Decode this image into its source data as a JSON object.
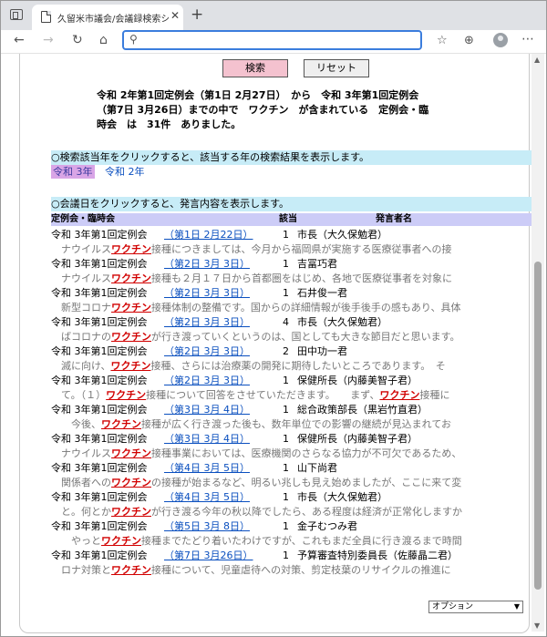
{
  "browser": {
    "tab_title": "久留米市議会/会議録検索システム",
    "tab_close": "✕",
    "new_tab": "+",
    "nav": {
      "back": "←",
      "forward": "→",
      "reload": "↻",
      "home": "⌂",
      "search_glyph": "⚲"
    },
    "address_value": "",
    "right_icons": {
      "favorites": "☆",
      "collections": "⊕",
      "menu": "⋯"
    }
  },
  "page": {
    "buttons": {
      "search_label": "検索",
      "reset_label": "リセット"
    },
    "summary": {
      "line1": "令和 2年第1回定例会（第1日 2月27日）　から　令和 3年第1回定例会",
      "line2": "（第7日 3月26日）までの中で　ワクチン　が含まれている　定例会・臨",
      "line3": "時会　は　31件　ありました。"
    },
    "year_hint": "○検索該当年をクリックすると、該当する年の検索結果を表示します。",
    "years": [
      "令和 3年",
      "令和 2年"
    ],
    "active_year": "令和 3年",
    "meeting_hint": "○会議日をクリックすると、発言内容を表示します。",
    "columns": {
      "meeting": "定例会・臨時会",
      "hits": "該当",
      "speaker": "発言者名"
    },
    "keyword": "ワクチン",
    "results": [
      {
        "session": "令和 3年第1回定例会",
        "date": "（第1日 2月22日）",
        "count": "1",
        "speaker": "市長（大久保勉君）",
        "pre": "　ナウイルス",
        "post": "接種につきましては、今月から福岡県が実施する医療従事者への接"
      },
      {
        "session": "令和 3年第1回定例会",
        "date": "（第2日 3月 3日）",
        "count": "1",
        "speaker": "吉冨巧君",
        "pre": "　ナウイルス",
        "post": "接種も２月１７日から首都圏をはじめ、各地で医療従事者を対象に"
      },
      {
        "session": "令和 3年第1回定例会",
        "date": "（第2日 3月 3日）",
        "count": "1",
        "speaker": "石井俊一君",
        "pre": "　新型コロナ",
        "post": "接種体制の整備です。国からの詳細情報が後手後手の感もあり、具体"
      },
      {
        "session": "令和 3年第1回定例会",
        "date": "（第2日 3月 3日）",
        "count": "4",
        "speaker": "市長（大久保勉君）",
        "pre": "　ばコロナの",
        "post": "が行き渡っていくというのは、国としても大きな節目だと思います。"
      },
      {
        "session": "令和 3年第1回定例会",
        "date": "（第2日 3月 3日）",
        "count": "2",
        "speaker": "田中功一君",
        "pre": "　滅に向け、",
        "post": "接種、さらには治療薬の開発に期待したいところであります。　そ"
      },
      {
        "session": "令和 3年第1回定例会",
        "date": "（第2日 3月 3日）",
        "count": "1",
        "speaker": "保健所長（内藤美智子君）",
        "pre": "　て。（１）",
        "post": "接種について回答をさせていただきます。　　まず、",
        "post_kw": "接種に"
      },
      {
        "session": "令和 3年第1回定例会",
        "date": "（第3日 3月 4日）",
        "count": "1",
        "speaker": "総合政策部長（黒岩竹直君）",
        "pre": "　　今後、",
        "post": "接種が広く行き渡った後も、数年単位での影響の継続が見込まれてお"
      },
      {
        "session": "令和 3年第1回定例会",
        "date": "（第3日 3月 4日）",
        "count": "1",
        "speaker": "保健所長（内藤美智子君）",
        "pre": "　ナウイルス",
        "post": "接種事業においては、医療機関のさらなる協力が不可欠であるため、"
      },
      {
        "session": "令和 3年第1回定例会",
        "date": "（第4日 3月 5日）",
        "count": "1",
        "speaker": "山下尚君",
        "pre": "　関係者への",
        "post": "の接種が始まるなど、明るい兆しも見え始めましたが、ここに来て変"
      },
      {
        "session": "令和 3年第1回定例会",
        "date": "（第4日 3月 5日）",
        "count": "1",
        "speaker": "市長（大久保勉君）",
        "pre": "　と。何とか",
        "post": "が行き渡る今年の秋以降でしたら、ある程度は経済が正常化しますか"
      },
      {
        "session": "令和 3年第1回定例会",
        "date": "（第5日 3月 8日）",
        "count": "1",
        "speaker": "金子むつみ君",
        "pre": "　　やっと",
        "post": "接種までたどり着いたわけですが、これもまだ全員に行き渡るまで時間"
      },
      {
        "session": "令和 3年第1回定例会",
        "date": "（第7日 3月26日）",
        "count": "1",
        "speaker": "予算審査特別委員長（佐藤晶二君）",
        "pre": "　ロナ対策と",
        "post": "接種について、児童虐待への対策、剪定枝葉のリサイクルの推進に"
      }
    ],
    "option_select": "オプション"
  }
}
